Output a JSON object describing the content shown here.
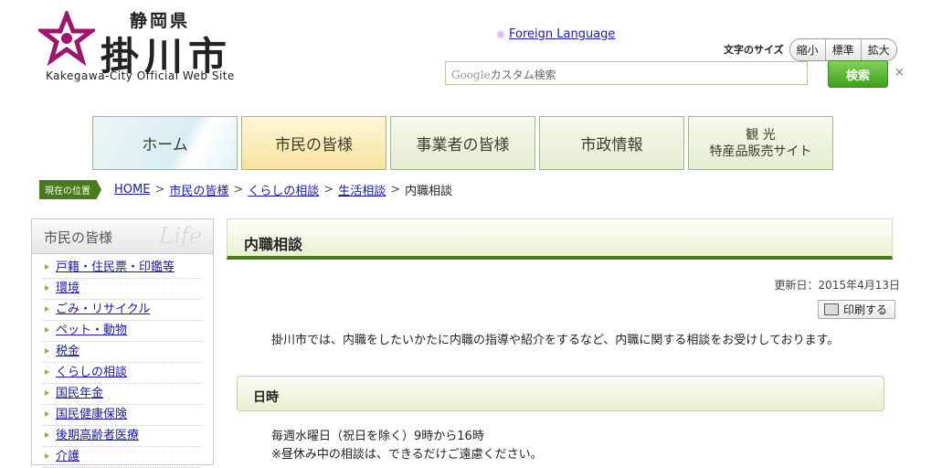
{
  "header": {
    "prefecture": "静岡県",
    "city": "掛川市",
    "site_subtitle": "Kakegawa-City Official Web Site",
    "foreign_language": "Foreign Language",
    "fontsize_label": "文字のサイズ",
    "fontsize_options": [
      "縮小",
      "標準",
      "拡大"
    ],
    "search_placeholder_brand": "Google",
    "search_placeholder": "カスタム検索",
    "search_button": "検索",
    "search_clear": "×"
  },
  "nav": [
    {
      "label": "ホーム"
    },
    {
      "label": "市民の皆様"
    },
    {
      "label": "事業者の皆様"
    },
    {
      "label": "市政情報"
    },
    {
      "label": "観 光\n特産品販売サイト"
    }
  ],
  "breadcrumb": {
    "here_label": "現在の位置",
    "items": [
      "HOME",
      "市民の皆様",
      "くらしの相談",
      "生活相談"
    ],
    "sep": ">",
    "current": "内職相談"
  },
  "sidebar": {
    "title": "市民の皆様",
    "title_en": "Life",
    "items": [
      "戸籍・住民票・印鑑等",
      "環境",
      "ごみ・リサイクル",
      "ペット・動物",
      "税金",
      "くらしの相談",
      "国民年金",
      "国民健康保険",
      "後期高齢者医療",
      "介護"
    ]
  },
  "main": {
    "title": "内職相談",
    "updated": "更新日：2015年4月13日",
    "print_label": "印刷する",
    "intro": "掛川市では、内職をしたいかたに内職の指導や紹介をするなど、内職に関する相談をお受けしております。",
    "section_title": "日時",
    "line1": "毎週水曜日（祝日を除く）9時から16時",
    "line2": "※昼休み中の相談は、できるだけご遠慮ください。"
  },
  "colors": {
    "accent_green": "#4c7a11",
    "search_button": "#3ea11a",
    "logo_magenta": "#a0146e"
  }
}
